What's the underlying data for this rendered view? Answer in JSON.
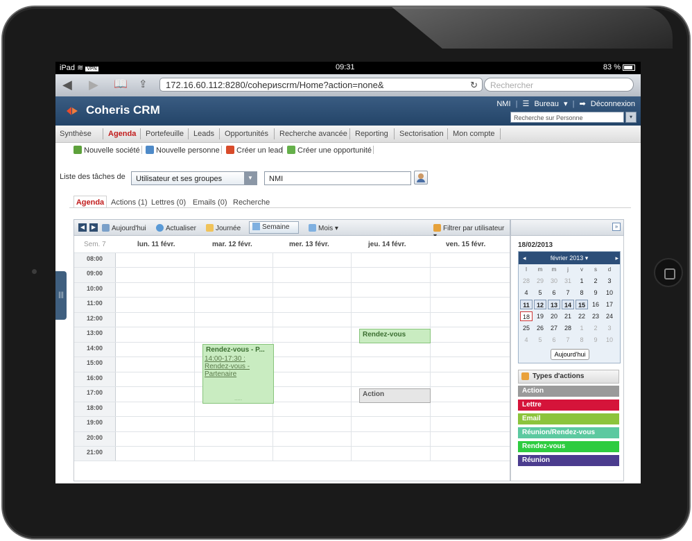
{
  "status": {
    "carrier": "iPad",
    "vpn": "VPN",
    "time": "09:31",
    "battery": "83 %"
  },
  "browser": {
    "url": "172.16.60.112:8280/cohериscrm/Home?action=none&",
    "search_placeholder": "Rechercher",
    "reload_icon": "reload-icon"
  },
  "app": {
    "name": "Coheris CRM",
    "user": "NMI",
    "desk": "Bureau",
    "logout": "Déconnexion",
    "search_placeholder": "Recherche sur Personne"
  },
  "menu": [
    "Synthèse",
    "Agenda",
    "Portefeuille",
    "Leads",
    "Opportunités",
    "Recherche avancée",
    "Reporting",
    "Sectorisation",
    "Mon compte"
  ],
  "actions": [
    "Nouvelle société",
    "Nouvelle personne",
    "Créer un lead",
    "Créer une opportunité"
  ],
  "tasks": {
    "label": "Liste des tâches de",
    "selected": "Utilisateur et ses groupes",
    "user_value": "NMI"
  },
  "subtabs": [
    "Agenda",
    "Actions (1)",
    "Lettres (0)",
    "Emails (0)",
    "Recherche"
  ],
  "toolbar": {
    "today": "Aujourd'hui",
    "refresh": "Actualiser",
    "day": "Journée",
    "week": "Semaine",
    "month": "Mois",
    "filter": "Filtrer par utilisateur"
  },
  "calendar": {
    "week_label": "Sem. 7",
    "days": [
      "lun. 11 févr.",
      "mar. 12 févr.",
      "mer. 13 févr.",
      "jeu. 14 févr.",
      "ven. 15 févr."
    ],
    "hours": [
      "08:00",
      "09:00",
      "10:00",
      "11:00",
      "12:00",
      "13:00",
      "14:00",
      "15:00",
      "16:00",
      "17:00",
      "18:00",
      "19:00",
      "20:00",
      "21:00"
    ],
    "events": [
      {
        "title": "Rendez-vous - P...",
        "detail": "14:00-17:30 : Rendez-vous - Partenaire",
        "more": "....."
      },
      {
        "title": "Rendez-vous"
      },
      {
        "title": "Action"
      }
    ]
  },
  "side": {
    "date": "18/02/2013",
    "month_label": "février 2013",
    "dow": [
      "l",
      "m",
      "m",
      "j",
      "v",
      "s",
      "d"
    ],
    "weeks": [
      [
        "28",
        "29",
        "30",
        "31",
        "1",
        "2",
        "3"
      ],
      [
        "4",
        "5",
        "6",
        "7",
        "8",
        "9",
        "10"
      ],
      [
        "11",
        "12",
        "13",
        "14",
        "15",
        "16",
        "17"
      ],
      [
        "18",
        "19",
        "20",
        "21",
        "22",
        "23",
        "24"
      ],
      [
        "25",
        "26",
        "27",
        "28",
        "1",
        "2",
        "3"
      ],
      [
        "4",
        "5",
        "6",
        "7",
        "8",
        "9",
        "10"
      ]
    ],
    "today_button": "Aujourd'hui",
    "types_title": "Types d'actions",
    "types": [
      {
        "label": "Action",
        "color": "#9a9a9a"
      },
      {
        "label": "Lettre",
        "color": "#d5143a"
      },
      {
        "label": "Email",
        "color": "#8cc43c"
      },
      {
        "label": "Réunion/Rendez-vous",
        "color": "#5cc9a0"
      },
      {
        "label": "Rendez-vous",
        "color": "#2ecc40"
      },
      {
        "label": "Réunion",
        "color": "#4b3c8e"
      }
    ]
  }
}
